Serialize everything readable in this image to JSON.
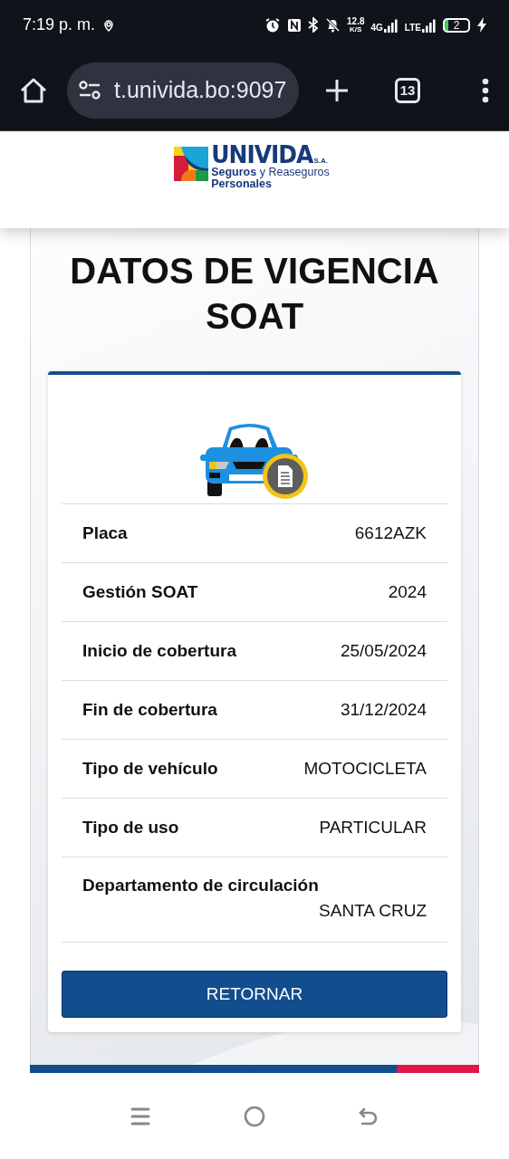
{
  "status_bar": {
    "time": "7:19 p. m.",
    "speed_value": "12.8",
    "speed_unit": "K/S",
    "network_1": "4G",
    "network_2": "LTE",
    "battery": "2"
  },
  "browser": {
    "url": "t.univida.bo:9097",
    "tab_count": "13"
  },
  "header": {
    "brand": "UNIVIDA",
    "brand_suffix": "S.A.",
    "tagline": "**Seguros** y Reaseguros",
    "tagline_2": "Personales"
  },
  "page": {
    "title": "DATOS DE VIGENCIA SOAT",
    "rows": [
      {
        "kind": "inline",
        "label": "Placa",
        "value": "6612AZK"
      },
      {
        "kind": "inline",
        "label": "Gestión SOAT",
        "value": "2024"
      },
      {
        "kind": "inline",
        "label": "Inicio de cobertura",
        "value": "25/05/2024"
      },
      {
        "kind": "inline",
        "label": "Fin de cobertura",
        "value": "31/12/2024"
      },
      {
        "kind": "inline",
        "label": "Tipo de vehículo",
        "value": "MOTOCICLETA"
      },
      {
        "kind": "inline",
        "label": "Tipo de uso",
        "value": "PARTICULAR"
      },
      {
        "kind": "stacked",
        "label": "Departamento de circulación",
        "value": "SANTA CRUZ"
      }
    ],
    "button": "RETORNAR"
  }
}
